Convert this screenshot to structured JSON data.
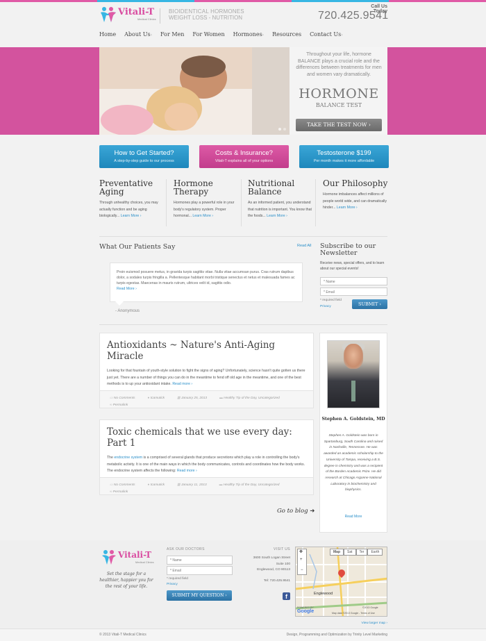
{
  "header": {
    "brand": "Vitali-T",
    "brand_sub": "Medical Clinics",
    "tagline_line1": "BIOIDENTICAL HORMONES",
    "tagline_line2": "WEIGHT LOSS - NUTRITION",
    "call_label": "Call Us Today",
    "phone": "720.425.9541"
  },
  "nav": [
    {
      "label": "Home",
      "caret": ""
    },
    {
      "label": "About Us",
      "caret": "›"
    },
    {
      "label": "For Men",
      "caret": ""
    },
    {
      "label": "For Women",
      "caret": ""
    },
    {
      "label": "Hormones",
      "caret": "›"
    },
    {
      "label": "Resources",
      "caret": ""
    },
    {
      "label": "Contact Us",
      "caret": "›"
    }
  ],
  "hero": {
    "copy": "Throughout your life, hormone BALANCE plays a crucial role and the differences between treatments for men and women vary dramatically.",
    "big": "HORMONE",
    "small": "BALANCE TEST",
    "button": "TAKE THE TEST NOW ›"
  },
  "features": [
    {
      "title": "How to Get Started?",
      "sub": "A step-by-step guide to our process"
    },
    {
      "title": "Costs & Insurance?",
      "sub": "Vitali-T explains all of your options"
    },
    {
      "title": "Testosterone $199",
      "sub": "Per month makes it more affordable"
    }
  ],
  "columns": [
    {
      "title": "Preventative Aging",
      "text": "Through unhealthy choices, you may actually function and be aging biologically...",
      "more": "Learn More ›"
    },
    {
      "title": "Hormone Therapy",
      "text": "Hormones play a powerful role in your body's regulatory system. Proper hormonal...",
      "more": "Learn More ›"
    },
    {
      "title": "Nutritional Balance",
      "text": "As an informed patient, you understand that nutrition is important. You know that the foods...",
      "more": "Learn More ›"
    },
    {
      "title": "Our Philosophy",
      "text": "Hormone imbalances affect millions of people world wide, and can dramatically hinder...",
      "more": "Learn More ›"
    }
  ],
  "patients": {
    "title": "What Our Patients Say",
    "read_all": "Read All",
    "quote": "Proin euismod posuere metus, in gravida turpis sagittis vitae. Nulla vitae accumsan purus. Cras rutrum dapibus dolor, a sodales turpis fringilla a. Pellentesque habitant morbi tristique senectus et netus et malesuada fames ac turpis egestas. Maecenas in mauris rutrum, ultrices velit id, sagittis odio.",
    "read_more": "Read More ›",
    "author": "- Anonymous"
  },
  "subscribe": {
    "title": "Subscribe to our Newsletter",
    "desc": "Receive news, special offers, and to learn about our special events!",
    "name_ph": "* Name",
    "email_ph": "* Email",
    "required": "* required field",
    "privacy": "Privacy",
    "button": "SUBMIT ›"
  },
  "posts": [
    {
      "title": "Antioxidants ~ Nature's Anti-Aging Miracle",
      "text": "Looking for that fountain of youth-style solution to fight the signs of aging? Unfortunately, science hasn't quite gotten us there just yet. There are a number of things you can do in the meantime to fend off old age in the meantime, and one of the best methods is to up your antioxidant intake.",
      "more": "Read more ›",
      "comments": "No Comments",
      "author": "tcamutick",
      "date": "January 25, 2013",
      "cats": "Healthy Tip of the Day, Uncategorized",
      "permalink": "Permalink"
    },
    {
      "title": "Toxic chemicals that we use every day: Part 1",
      "text_link": "endocrine system",
      "text_pre": "The ",
      "text": " is a comprised of several glands that produce secretions which play a role in controlling the body's metabolic activity.  It is one of the main ways in which the body communicates, controls and coordinates how the body works.  The endocrine system affects the following:",
      "more": "Read more ›",
      "comments": "No Comments",
      "author": "tcamutick",
      "date": "January 11, 2013",
      "cats": "Healthy Tip of the Day, Uncategorized",
      "permalink": "Permalink"
    }
  ],
  "goto_blog": "Go to blog",
  "doctor": {
    "name": "Stephen A. Goldstein, MD",
    "bio": "Stephen A. Goldstein was born in Spartanburg, South Carolina and raised in Nashville, Tennessee. He was awarded an academic scholarship to the University of Tampa, receiving a B.S. degree in chemistry and was a recipient of the Borden Academic Prize. He did research at Chicago Argonne National Laboratory in biochemistry and biophysics.",
    "more": "Read More"
  },
  "footer": {
    "slogan": "Set the stage for a healthier, happier you for the rest of your life.",
    "ask_title": "ASK OUR DOCTORS",
    "name_ph": "* Name",
    "email_ph": "* Email",
    "required": "* required field",
    "privacy": "Privacy",
    "button": "SUBMIT MY QUESTION ›",
    "visit_title": "VISIT US",
    "addr1": "3600 South Logan Street",
    "addr2": "Suite 100",
    "addr3": "Englewood, CO 80113",
    "tel": "Tel: 720.425.9541",
    "map_tabs": [
      "Map",
      "Sat",
      "Ter",
      "Earth"
    ],
    "map_city": "Englewood",
    "map_copy": "©2013 Google",
    "map_data": "Map data ©2013 Google - Terms of Use",
    "google": "Google",
    "powered": "POWERED BY",
    "larger_map": "View larger map ›",
    "copyright": "© 2013 Vitali-T Medical Clinics",
    "credit": "Design, Programming and Optimization by Trinity Level Marketing"
  }
}
